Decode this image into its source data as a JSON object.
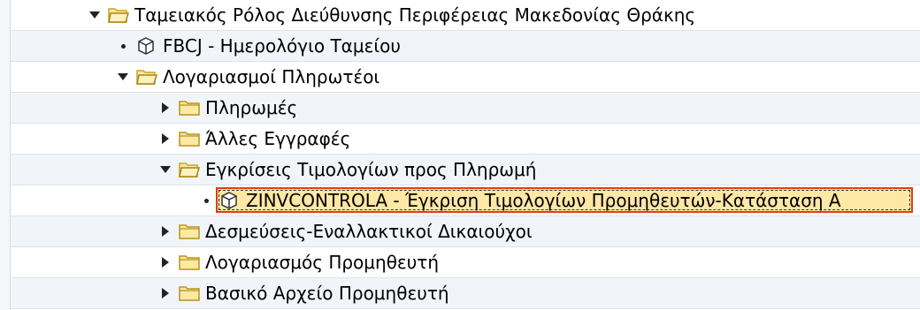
{
  "tree": {
    "nodes": [
      {
        "label": "Ταμειακός Ρόλος Διεύθυνσης Περιφέρειας Μακεδονίας Θράκης",
        "type": "folder",
        "state": "expanded"
      },
      {
        "label": "FBCJ - Ημερολόγιο Ταμείου",
        "type": "transaction"
      },
      {
        "label": "Λογαριασμοί Πληρωτέοι",
        "type": "folder",
        "state": "expanded"
      },
      {
        "label": "Πληρωμές",
        "type": "folder",
        "state": "collapsed"
      },
      {
        "label": "Άλλες Εγγραφές",
        "type": "folder",
        "state": "collapsed"
      },
      {
        "label": "Εγκρίσεις Τιμολογίων προς Πληρωμή",
        "type": "folder",
        "state": "expanded"
      },
      {
        "label": "ZINVCONTROLA - Έγκριση Τιμολογίων Προμηθευτών-Κατάσταση Α",
        "type": "transaction",
        "selected": true
      },
      {
        "label": "Δεσμεύσεις-Εναλλακτικοί Δικαιούχοι",
        "type": "folder",
        "state": "collapsed"
      },
      {
        "label": "Λογαριασμός Προμηθευτή",
        "type": "folder",
        "state": "collapsed"
      },
      {
        "label": "Βασικό Αρχείο Προμηθευτή",
        "type": "folder",
        "state": "collapsed"
      }
    ]
  },
  "colors": {
    "selection_fill": "#ffe7a6",
    "selection_border": "#e23b1c",
    "folder_fill": "#fbe9a4",
    "folder_stroke": "#c9a227",
    "row_divider": "#dbe3ec"
  }
}
